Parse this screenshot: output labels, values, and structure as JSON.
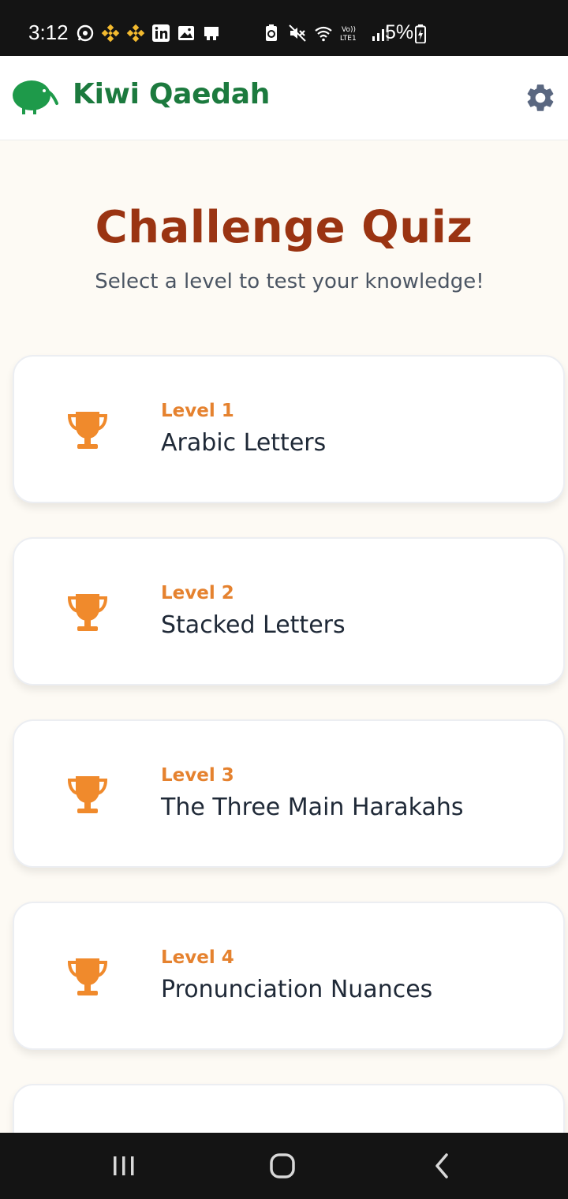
{
  "status_bar": {
    "time": "3:12",
    "battery": "5%",
    "left_icons": [
      "whatsapp-icon",
      "binance-icon",
      "binance-icon",
      "linkedin-icon",
      "gallery-icon",
      "store-icon"
    ],
    "right_icons": [
      "battery-saver-icon",
      "mute-icon",
      "wifi-icon",
      "volte-icon",
      "signal-icon"
    ]
  },
  "app_bar": {
    "title": "Kiwi Qaedah",
    "brand_color": "#1c7a3e",
    "logo_icon": "kiwi-bird-icon",
    "settings_icon": "gear-icon"
  },
  "page": {
    "title": "Challenge Quiz",
    "subtitle": "Select a level to test your knowledge!",
    "title_color": "#9a3412"
  },
  "levels": [
    {
      "level": "Level 1",
      "title": "Arabic Letters"
    },
    {
      "level": "Level 2",
      "title": "Stacked Letters"
    },
    {
      "level": "Level 3",
      "title": "The Three Main Harakahs"
    },
    {
      "level": "Level 4",
      "title": "Pronunciation Nuances"
    },
    {
      "level": "",
      "title": ""
    }
  ],
  "accent_color": "#f08a2c",
  "nav_bar": {
    "buttons": [
      "recent-apps-icon",
      "home-icon",
      "back-icon"
    ]
  }
}
